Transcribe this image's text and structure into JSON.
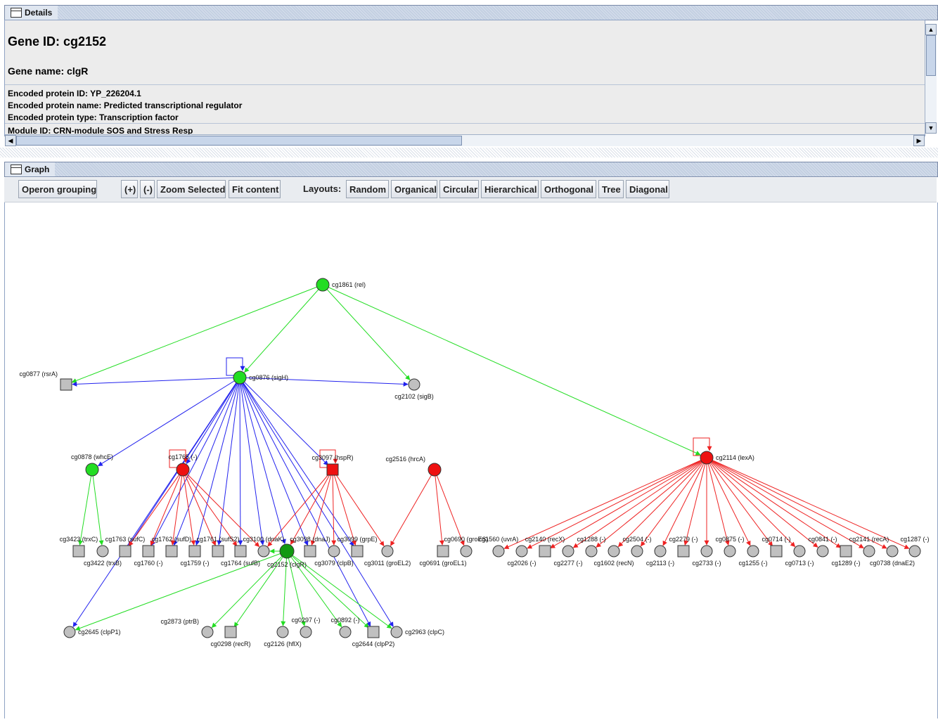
{
  "details": {
    "panel_title": "Details",
    "gene_id": "Gene ID: cg2152",
    "gene_name": "Gene name: clgR",
    "lines": [
      "Encoded protein ID: YP_226204.1",
      "Encoded protein name: Predicted transcriptional regulator",
      "Encoded protein type: Transcription factor",
      "Module ID:  CRN-module SOS and Stress Resp"
    ],
    "scroll_up": "▲",
    "scroll_down": "▼",
    "scroll_left": "◀",
    "scroll_right": "▶"
  },
  "graph_panel": {
    "panel_title": "Graph",
    "toolbar": {
      "operon_grouping": "Operon grouping",
      "zoom_in": "(+)",
      "zoom_out": "(-)",
      "zoom_selected": "Zoom Selected",
      "fit_content": "Fit content",
      "layouts_label": "Layouts:",
      "layouts": [
        "Random",
        "Organical",
        "Circular",
        "Hierarchical",
        "Orthogonal",
        "Tree",
        "Diagonal"
      ]
    }
  },
  "colors": {
    "activator": "#22dd22",
    "repressor": "#ee2222",
    "sigma": "#2222ee",
    "node_grey": "#c0c0c0",
    "node_green": "#22dd22",
    "node_red": "#ee1111",
    "node_dark_green": "#119911"
  },
  "nodes": [
    {
      "id": "cg1861",
      "label": "cg1861 (rel)",
      "shape": "circle",
      "color": "green"
    },
    {
      "id": "cg0877",
      "label": "cg0877 (rsrA)",
      "shape": "square",
      "color": "grey"
    },
    {
      "id": "cg0876",
      "label": "cg0876 (sigH)",
      "shape": "circle",
      "color": "green"
    },
    {
      "id": "cg2102",
      "label": "cg2102 (sigB)",
      "shape": "circle",
      "color": "grey"
    },
    {
      "id": "cg2114",
      "label": "cg2114 (lexA)",
      "shape": "circle",
      "color": "red"
    },
    {
      "id": "cg0878",
      "label": "cg0878 (whcE)",
      "shape": "circle",
      "color": "green"
    },
    {
      "id": "cg1765",
      "label": "cg1765 (-)",
      "shape": "circle",
      "color": "red"
    },
    {
      "id": "cg3097",
      "label": "cg3097 (hspR)",
      "shape": "square",
      "color": "red"
    },
    {
      "id": "cg2516",
      "label": "cg2516 (hrcA)",
      "shape": "circle",
      "color": "red"
    },
    {
      "id": "cg3423",
      "label": "cg3423 (trxC)",
      "shape": "square",
      "color": "grey"
    },
    {
      "id": "cg3422",
      "label": "cg3422 (trxB)",
      "shape": "circle",
      "color": "grey"
    },
    {
      "id": "cg1763",
      "label": "cg1763 (sufC)",
      "shape": "square",
      "color": "grey"
    },
    {
      "id": "cg1760",
      "label": "cg1760 (-)",
      "shape": "square",
      "color": "grey"
    },
    {
      "id": "cg1762",
      "label": "cg1762 (sufD)",
      "shape": "square",
      "color": "grey"
    },
    {
      "id": "cg1759",
      "label": "cg1759 (-)",
      "shape": "square",
      "color": "grey"
    },
    {
      "id": "cg1761",
      "label": "cg1761 (sufS2)",
      "shape": "square",
      "color": "grey"
    },
    {
      "id": "cg1764",
      "label": "cg1764 (sufB)",
      "shape": "square",
      "color": "grey"
    },
    {
      "id": "cg3100",
      "label": "cg3100 (dnaK)",
      "shape": "circle",
      "color": "grey"
    },
    {
      "id": "cg2152",
      "label": "cg2152 (clgR)",
      "shape": "circle",
      "color": "darkgreen"
    },
    {
      "id": "cg3098",
      "label": "cg3098 (dnaJ)",
      "shape": "square",
      "color": "grey"
    },
    {
      "id": "cg3079",
      "label": "cg3079 (clpB)",
      "shape": "circle",
      "color": "grey"
    },
    {
      "id": "cg3099",
      "label": "cg3099 (grpE)",
      "shape": "square",
      "color": "grey"
    },
    {
      "id": "cg3011",
      "label": "cg3011 (groEL2)",
      "shape": "circle",
      "color": "grey"
    },
    {
      "id": "cg0691",
      "label": "cg0691 (groEL1)",
      "shape": "square",
      "color": "grey"
    },
    {
      "id": "cg0690",
      "label": "cg0690 (groES)",
      "shape": "circle",
      "color": "grey"
    },
    {
      "id": "cg1560",
      "label": "cg1560 (uvrA)",
      "shape": "circle",
      "color": "grey"
    },
    {
      "id": "cg2026",
      "label": "cg2026 (-)",
      "shape": "circle",
      "color": "grey"
    },
    {
      "id": "cg2140",
      "label": "cg2140 (recX)",
      "shape": "square",
      "color": "grey"
    },
    {
      "id": "cg2277",
      "label": "cg2277 (-)",
      "shape": "circle",
      "color": "grey"
    },
    {
      "id": "cg1288",
      "label": "cg1288 (-)",
      "shape": "circle",
      "color": "grey"
    },
    {
      "id": "cg1602",
      "label": "cg1602 (recN)",
      "shape": "circle",
      "color": "grey"
    },
    {
      "id": "cg2504",
      "label": "cg2504 (-)",
      "shape": "circle",
      "color": "grey"
    },
    {
      "id": "cg2113",
      "label": "cg2113 (-)",
      "shape": "circle",
      "color": "grey"
    },
    {
      "id": "cg2279",
      "label": "cg2279 (-)",
      "shape": "square",
      "color": "grey"
    },
    {
      "id": "cg2733",
      "label": "cg2733 (-)",
      "shape": "circle",
      "color": "grey"
    },
    {
      "id": "cg0875",
      "label": "cg0875 (-)",
      "shape": "circle",
      "color": "grey"
    },
    {
      "id": "cg1255",
      "label": "cg1255 (-)",
      "shape": "circle",
      "color": "grey"
    },
    {
      "id": "cg0714",
      "label": "cg0714 (-)",
      "shape": "square",
      "color": "grey"
    },
    {
      "id": "cg0713",
      "label": "cg0713 (-)",
      "shape": "circle",
      "color": "grey"
    },
    {
      "id": "cg0841",
      "label": "cg0841 (-)",
      "shape": "circle",
      "color": "grey"
    },
    {
      "id": "cg1289",
      "label": "cg1289 (-)",
      "shape": "square",
      "color": "grey"
    },
    {
      "id": "cg2141",
      "label": "cg2141 (recA)",
      "shape": "circle",
      "color": "grey"
    },
    {
      "id": "cg0738",
      "label": "cg0738 (dnaE2)",
      "shape": "circle",
      "color": "grey"
    },
    {
      "id": "cg1287",
      "label": "cg1287 (-)",
      "shape": "circle",
      "color": "grey"
    },
    {
      "id": "cg2645",
      "label": "cg2645 (clpP1)",
      "shape": "circle",
      "color": "grey"
    },
    {
      "id": "cg2873",
      "label": "cg2873 (ptrB)",
      "shape": "circle",
      "color": "grey"
    },
    {
      "id": "cg0298",
      "label": "cg0298 (recR)",
      "shape": "square",
      "color": "grey"
    },
    {
      "id": "cg2126",
      "label": "cg2126 (hflX)",
      "shape": "circle",
      "color": "grey"
    },
    {
      "id": "cg0297",
      "label": "cg0297 (-)",
      "shape": "circle",
      "color": "grey"
    },
    {
      "id": "cg0892",
      "label": "cg0892 (-)",
      "shape": "circle",
      "color": "grey"
    },
    {
      "id": "cg2644",
      "label": "cg2644 (clpP2)",
      "shape": "square",
      "color": "grey"
    },
    {
      "id": "cg2963",
      "label": "cg2963 (clpC)",
      "shape": "circle",
      "color": "grey"
    }
  ],
  "edges": [
    {
      "from": "cg1861",
      "to": "cg0877",
      "type": "activator"
    },
    {
      "from": "cg1861",
      "to": "cg0876",
      "type": "activator"
    },
    {
      "from": "cg1861",
      "to": "cg2102",
      "type": "activator"
    },
    {
      "from": "cg1861",
      "to": "cg2114",
      "type": "activator"
    },
    {
      "from": "cg0876",
      "to": "cg0876",
      "type": "sigma"
    },
    {
      "from": "cg0876",
      "to": "cg0877",
      "type": "sigma"
    },
    {
      "from": "cg0876",
      "to": "cg2102",
      "type": "sigma"
    },
    {
      "from": "cg0876",
      "to": "cg0878",
      "type": "sigma"
    },
    {
      "from": "cg0876",
      "to": "cg1765",
      "type": "sigma"
    },
    {
      "from": "cg0876",
      "to": "cg3097",
      "type": "sigma"
    },
    {
      "from": "cg0876",
      "to": "cg1763",
      "type": "sigma"
    },
    {
      "from": "cg0876",
      "to": "cg1760",
      "type": "sigma"
    },
    {
      "from": "cg0876",
      "to": "cg1762",
      "type": "sigma"
    },
    {
      "from": "cg0876",
      "to": "cg1759",
      "type": "sigma"
    },
    {
      "from": "cg0876",
      "to": "cg1761",
      "type": "sigma"
    },
    {
      "from": "cg0876",
      "to": "cg1764",
      "type": "sigma"
    },
    {
      "from": "cg0876",
      "to": "cg3100",
      "type": "sigma"
    },
    {
      "from": "cg0876",
      "to": "cg2152",
      "type": "sigma"
    },
    {
      "from": "cg0876",
      "to": "cg3098",
      "type": "sigma"
    },
    {
      "from": "cg0876",
      "to": "cg3099",
      "type": "sigma"
    },
    {
      "from": "cg0876",
      "to": "cg2645",
      "type": "sigma"
    },
    {
      "from": "cg0876",
      "to": "cg2644",
      "type": "sigma"
    },
    {
      "from": "cg0876",
      "to": "cg2963",
      "type": "sigma"
    },
    {
      "from": "cg0878",
      "to": "cg3423",
      "type": "activator"
    },
    {
      "from": "cg0878",
      "to": "cg3422",
      "type": "activator"
    },
    {
      "from": "cg1765",
      "to": "cg1765",
      "type": "repressor"
    },
    {
      "from": "cg1765",
      "to": "cg1763",
      "type": "repressor"
    },
    {
      "from": "cg1765",
      "to": "cg1760",
      "type": "repressor"
    },
    {
      "from": "cg1765",
      "to": "cg1762",
      "type": "repressor"
    },
    {
      "from": "cg1765",
      "to": "cg1759",
      "type": "repressor"
    },
    {
      "from": "cg1765",
      "to": "cg1761",
      "type": "repressor"
    },
    {
      "from": "cg1765",
      "to": "cg1764",
      "type": "repressor"
    },
    {
      "from": "cg1765",
      "to": "cg3100",
      "type": "repressor"
    },
    {
      "from": "cg3097",
      "to": "cg3097",
      "type": "repressor"
    },
    {
      "from": "cg3097",
      "to": "cg3100",
      "type": "repressor"
    },
    {
      "from": "cg3097",
      "to": "cg2152",
      "type": "repressor"
    },
    {
      "from": "cg3097",
      "to": "cg3098",
      "type": "repressor"
    },
    {
      "from": "cg3097",
      "to": "cg3079",
      "type": "repressor"
    },
    {
      "from": "cg3097",
      "to": "cg3099",
      "type": "repressor"
    },
    {
      "from": "cg3097",
      "to": "cg3011",
      "type": "repressor"
    },
    {
      "from": "cg2516",
      "to": "cg3011",
      "type": "repressor"
    },
    {
      "from": "cg2516",
      "to": "cg0691",
      "type": "repressor"
    },
    {
      "from": "cg2516",
      "to": "cg0690",
      "type": "repressor"
    },
    {
      "from": "cg2152",
      "to": "cg2645",
      "type": "activator"
    },
    {
      "from": "cg2152",
      "to": "cg2873",
      "type": "activator"
    },
    {
      "from": "cg2152",
      "to": "cg0298",
      "type": "activator"
    },
    {
      "from": "cg2152",
      "to": "cg2126",
      "type": "activator"
    },
    {
      "from": "cg2152",
      "to": "cg0297",
      "type": "activator"
    },
    {
      "from": "cg2152",
      "to": "cg0892",
      "type": "activator"
    },
    {
      "from": "cg2152",
      "to": "cg2644",
      "type": "activator"
    },
    {
      "from": "cg2152",
      "to": "cg2963",
      "type": "activator"
    },
    {
      "from": "cg2152",
      "to": "cg3100",
      "type": "activator"
    },
    {
      "from": "cg2114",
      "to": "cg2114",
      "type": "repressor"
    },
    {
      "from": "cg2114",
      "to": "cg1560",
      "type": "repressor"
    },
    {
      "from": "cg2114",
      "to": "cg2026",
      "type": "repressor"
    },
    {
      "from": "cg2114",
      "to": "cg2140",
      "type": "repressor"
    },
    {
      "from": "cg2114",
      "to": "cg2277",
      "type": "repressor"
    },
    {
      "from": "cg2114",
      "to": "cg1288",
      "type": "repressor"
    },
    {
      "from": "cg2114",
      "to": "cg1602",
      "type": "repressor"
    },
    {
      "from": "cg2114",
      "to": "cg2504",
      "type": "repressor"
    },
    {
      "from": "cg2114",
      "to": "cg2113",
      "type": "repressor"
    },
    {
      "from": "cg2114",
      "to": "cg2279",
      "type": "repressor"
    },
    {
      "from": "cg2114",
      "to": "cg2733",
      "type": "repressor"
    },
    {
      "from": "cg2114",
      "to": "cg0875",
      "type": "repressor"
    },
    {
      "from": "cg2114",
      "to": "cg1255",
      "type": "repressor"
    },
    {
      "from": "cg2114",
      "to": "cg0714",
      "type": "repressor"
    },
    {
      "from": "cg2114",
      "to": "cg0713",
      "type": "repressor"
    },
    {
      "from": "cg2114",
      "to": "cg0841",
      "type": "repressor"
    },
    {
      "from": "cg2114",
      "to": "cg1289",
      "type": "repressor"
    },
    {
      "from": "cg2114",
      "to": "cg2141",
      "type": "repressor"
    },
    {
      "from": "cg2114",
      "to": "cg0738",
      "type": "repressor"
    },
    {
      "from": "cg2114",
      "to": "cg1287",
      "type": "repressor"
    }
  ]
}
